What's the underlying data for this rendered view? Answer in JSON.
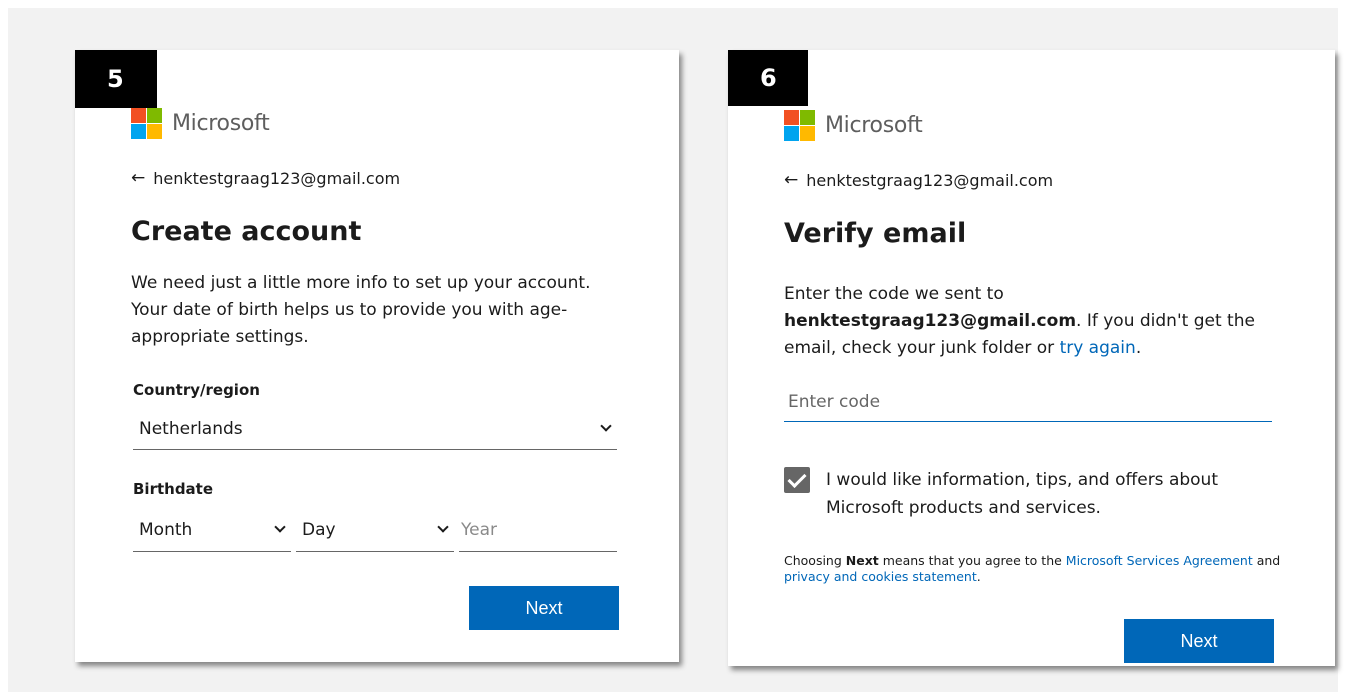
{
  "brand": {
    "name": "Microsoft",
    "colors": {
      "red": "#f25022",
      "green": "#7fba00",
      "blue": "#00a4ef",
      "yellow": "#ffb900",
      "accent": "#0067b8"
    }
  },
  "step5": {
    "badge": "5",
    "back_email": "henktestgraag123@gmail.com",
    "title": "Create account",
    "description": "We need just a little more info to set up your account. Your date of birth helps us to provide you with age-appropriate settings.",
    "country_label": "Country/region",
    "country_value": "Netherlands",
    "birthdate_label": "Birthdate",
    "month_value": "Month",
    "day_value": "Day",
    "year_placeholder": "Year",
    "next_label": "Next"
  },
  "step6": {
    "badge": "6",
    "back_email": "henktestgraag123@gmail.com",
    "title": "Verify email",
    "desc_prefix": "Enter the code we sent to",
    "desc_email": "henktestgraag123@gmail.com",
    "desc_middle": ". If you didn't get the email, check your junk folder or ",
    "desc_link": "try again",
    "desc_end": ".",
    "code_placeholder": "Enter code",
    "checkbox_checked": true,
    "checkbox_label": "I would like information, tips, and offers about Microsoft products and services.",
    "legal_prefix": "Choosing ",
    "legal_bold": "Next",
    "legal_middle": " means that you agree to the ",
    "legal_link1": "Microsoft Services Agreement",
    "legal_and": " and ",
    "legal_link2": "privacy and cookies statement",
    "legal_end": ".",
    "next_label": "Next"
  }
}
